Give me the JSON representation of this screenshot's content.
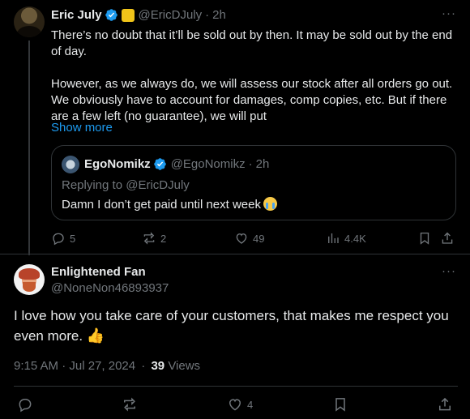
{
  "parent_tweet": {
    "author_name": "Eric July",
    "handle": "@EricDJuly",
    "separator": "·",
    "time": "2h",
    "paragraph1": "There’s no doubt that it’ll be sold out by then. It may be sold out by the end of day.",
    "paragraph2": "However, as we always do, we will assess our stock after all orders go out. We obviously have to account for damages, comp copies, etc. But if there are a few left (no guarantee), we will put",
    "show_more": "Show more",
    "quote": {
      "author_name": "EgoNomikz",
      "handle": "@EgoNomikz",
      "separator": "·",
      "time": "2h",
      "replying_to": "Replying to @EricDJuly",
      "text": "Damn I don’t get paid until next week"
    },
    "stats": {
      "replies": "5",
      "reposts": "2",
      "likes": "49",
      "views": "4.4K"
    }
  },
  "reply_tweet": {
    "author_name": "Enlightened Fan",
    "handle": "@NoneNon46893937",
    "text": "I love how you take care of your customers, that makes me respect you even more.",
    "timestamp": "9:15 AM · Jul 27, 2024",
    "meta_separator": "·",
    "views_count": "39",
    "views_label": "Views",
    "stats": {
      "likes": "4"
    }
  },
  "more_label": "···",
  "colors": {
    "background": "#000000",
    "text": "#e7e9ea",
    "muted": "#71767b",
    "accent": "#1d9bf0",
    "border": "#2f3336"
  },
  "icons": [
    "verified-icon",
    "subscriber-badge-icon",
    "more-icon",
    "reply-icon",
    "repost-icon",
    "like-icon",
    "views-icon",
    "bookmark-icon",
    "share-icon",
    "crying-emoji-icon",
    "thumbs-up-emoji-icon"
  ]
}
